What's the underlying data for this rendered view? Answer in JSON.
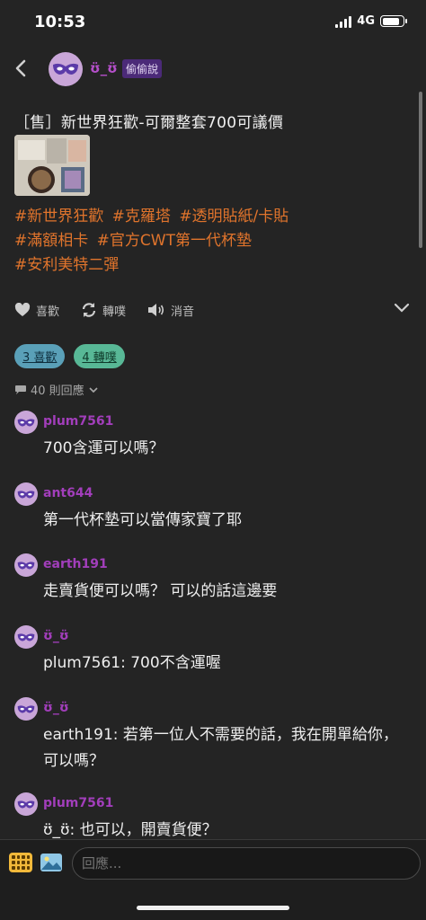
{
  "status_bar": {
    "time": "10:53",
    "network": "4G"
  },
  "header": {
    "author": "ʊ̈_ʊ̈",
    "badge": "偷偷說"
  },
  "post": {
    "title": "［售］新世界狂歡-可爾整套700可議價",
    "tags": [
      "#新世界狂歡",
      "#克羅塔",
      "#透明貼紙/卡貼",
      "#滿額相卡",
      "#官方CWT第一代杯墊",
      "#安利美特二彈"
    ]
  },
  "actions": {
    "like": "喜歡",
    "share": "轉噗",
    "mute": "消音"
  },
  "stats": {
    "likes": "3 喜歡",
    "shares": "4 轉噗",
    "reply_count": "40 則回應"
  },
  "comments": [
    {
      "name": "plum7561",
      "text": "700含運可以嗎？"
    },
    {
      "name": "ant644",
      "text": "第一代杯墊可以當傳家寶了耶"
    },
    {
      "name": "earth191",
      "text": "走賣貨便可以嗎？ 可以的話這邊要"
    },
    {
      "name": "ʊ̈_ʊ̈",
      "text": "plum7561: 700不含運喔"
    },
    {
      "name": "ʊ̈_ʊ̈",
      "text": "earth191: 若第一位人不需要的話，我在開單給你，可以嗎？"
    },
    {
      "name": "plum7561",
      "text": "ʊ̈_ʊ̈: 也可以，開賣貨便？"
    }
  ],
  "reply": {
    "placeholder": "回應..."
  },
  "colors": {
    "background": "#242424",
    "username": "#a23ebb",
    "tag": "#e0742c",
    "badge": "#4b2a78"
  },
  "icons": [
    "back-icon",
    "mask-icon",
    "heart-icon",
    "replurk-icon",
    "mute-icon",
    "chevron-down-icon",
    "speech-bubble-icon",
    "keyboard-icon",
    "image-icon"
  ]
}
